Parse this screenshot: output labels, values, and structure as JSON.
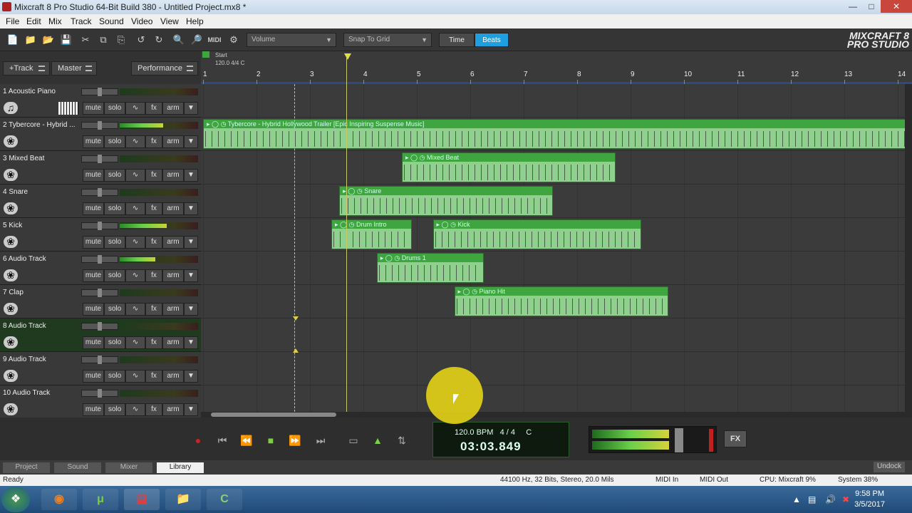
{
  "window": {
    "title": "Mixcraft 8 Pro Studio 64-Bit Build 380 - Untitled Project.mx8 *"
  },
  "menu": [
    "File",
    "Edit",
    "Mix",
    "Track",
    "Sound",
    "Video",
    "View",
    "Help"
  ],
  "toolbar": {
    "volume_dropdown": "Volume",
    "snap_dropdown": "Snap To Grid",
    "time_btn": "Time",
    "beats_btn": "Beats",
    "accent": "#1ea0e0",
    "logo_line1": "MIXCRAFT 8",
    "logo_line2": "PRO STUDIO"
  },
  "header": {
    "add_track": "+Track",
    "master": "Master",
    "performance": "Performance"
  },
  "ruler": {
    "start_label": "Start",
    "tempo_label": "120.0 4/4 C",
    "numbers": [
      "1",
      "2",
      "3",
      "4",
      "5",
      "6",
      "7",
      "8",
      "9",
      "10",
      "11",
      "12",
      "13",
      "14"
    ]
  },
  "track_buttons": {
    "mute": "mute",
    "solo": "solo",
    "fx": "fx",
    "arm": "arm"
  },
  "tracks": [
    {
      "name": "1 Acoustic Piano",
      "level": 0.0
    },
    {
      "name": "2 Tybercore - Hybrid ...",
      "level": 0.55
    },
    {
      "name": "3 Mixed Beat",
      "level": 0.0
    },
    {
      "name": "4 Snare",
      "level": 0.0
    },
    {
      "name": "5 Kick",
      "level": 0.6
    },
    {
      "name": "6 Audio Track",
      "level": 0.45
    },
    {
      "name": "7 Clap",
      "level": 0.0
    },
    {
      "name": "8 Audio Track",
      "level": 0.0
    },
    {
      "name": "9 Audio Track",
      "level": 0.0
    },
    {
      "name": "10 Audio Track",
      "level": 0.0
    }
  ],
  "clips": [
    {
      "name": "Tybercore - Hybrid Hollywood Trailer [Epic Inspiring Suspense Music]",
      "track": 1
    },
    {
      "name": "Mixed Beat",
      "track": 2
    },
    {
      "name": "Snare",
      "track": 3
    },
    {
      "name": "Drum Intro",
      "track": 4
    },
    {
      "name": "Kick",
      "track": 4
    },
    {
      "name": "Drums 1",
      "track": 5
    },
    {
      "name": "Piano Hit",
      "track": 6
    }
  ],
  "transport": {
    "bpm": "120.0 BPM",
    "meter": "4 / 4",
    "key": "C",
    "time": "03:03.849",
    "fx": "FX"
  },
  "tabs": {
    "project": "Project",
    "sound": "Sound",
    "mixer": "Mixer",
    "library": "Library",
    "undock": "Undock"
  },
  "status": {
    "ready": "Ready",
    "audio": "44100 Hz, 32 Bits, Stereo, 20.0 Mils",
    "midi_in": "MIDI In",
    "midi_out": "MIDI Out",
    "cpu": "CPU: Mixcraft 9%",
    "system": "System 38%"
  },
  "taskbar": {
    "time": "9:58 PM",
    "date": "3/5/2017"
  }
}
